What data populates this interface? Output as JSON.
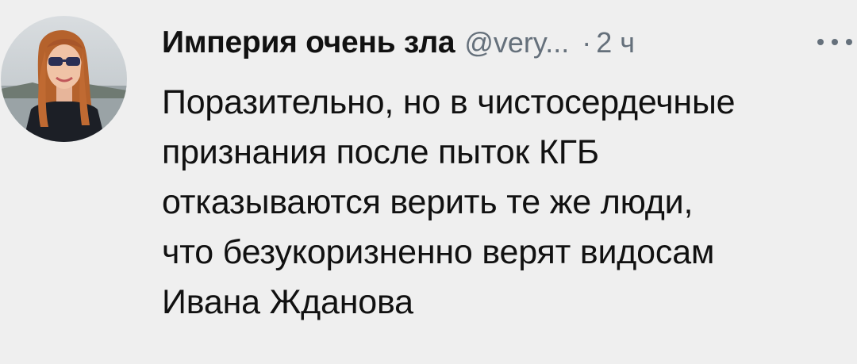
{
  "tweet": {
    "author_name": "Империя очень зла",
    "handle": "@very...",
    "separator": "·",
    "time": "2 ч",
    "more_icon": "more-horizontal-icon",
    "text_lines": [
      "Поразительно, но в чистосердечные",
      "признания после пыток КГБ",
      "отказываются верить те же люди,",
      "что безукоризненно верят видосам",
      "Ивана Жданова"
    ]
  },
  "colors": {
    "background": "#efefef",
    "primary_text": "#111111",
    "secondary_text": "#65707b"
  }
}
